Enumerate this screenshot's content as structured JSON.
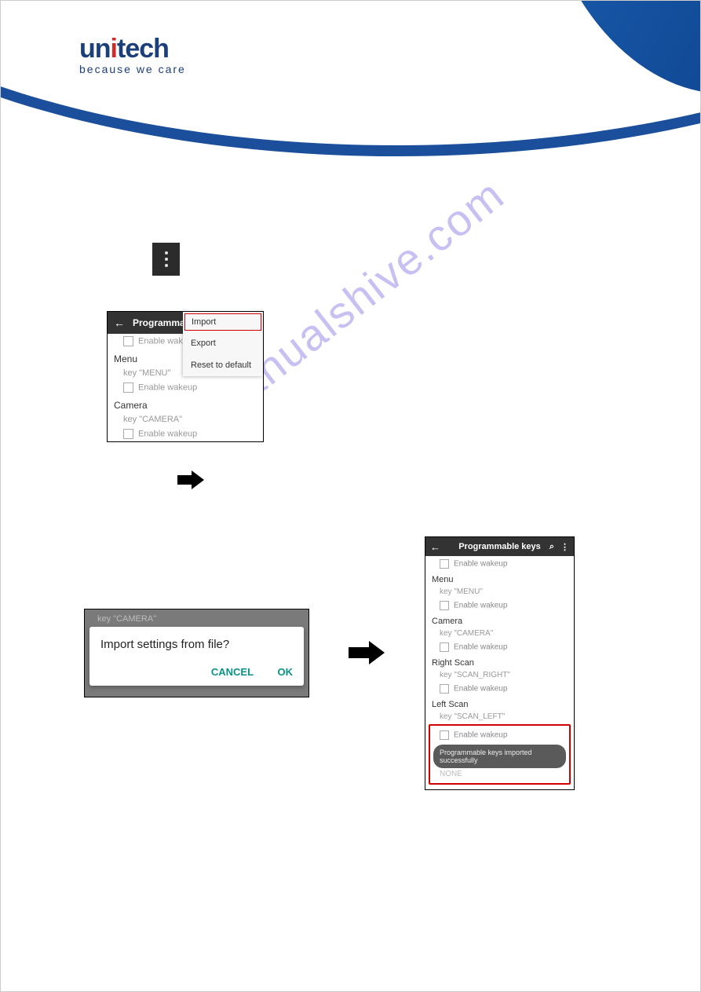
{
  "logo": {
    "brand_pre": "un",
    "brand_i": "i",
    "brand_post": "tech",
    "tagline": "because we care"
  },
  "watermark": "manualshive.com",
  "shot1": {
    "title": "Programma",
    "menu": {
      "import": "Import",
      "export": "Export",
      "reset": "Reset to default"
    },
    "enable_wakeup": "Enable wakeup",
    "sec_menu": "Menu",
    "key_menu": "key \"MENU\"",
    "sec_camera": "Camera",
    "key_camera": "key \"CAMERA\""
  },
  "dialog": {
    "bg_label": "key \"CAMERA\"",
    "question": "Import settings from file?",
    "cancel": "CANCEL",
    "ok": "OK"
  },
  "shot3": {
    "title": "Programmable keys",
    "enable_wakeup": "Enable wakeup",
    "sec_menu": "Menu",
    "key_menu": "key \"MENU\"",
    "sec_camera": "Camera",
    "key_camera": "key \"CAMERA\"",
    "sec_right": "Right Scan",
    "key_right": "key \"SCAN_RIGHT\"",
    "sec_left": "Left Scan",
    "key_left": "key \"SCAN_LEFT\"",
    "toast": "Programmable keys imported successfully",
    "none": "NONE"
  }
}
